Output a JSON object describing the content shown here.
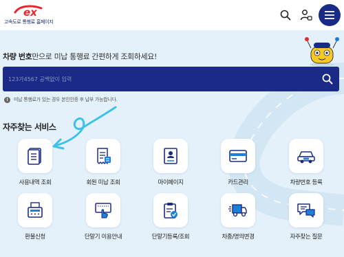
{
  "header": {
    "logo_text": "고속도로 통행료 홈페이지"
  },
  "main": {
    "title_bold": "차량 번호",
    "title_rest": "만으로 미납 통행료 간편하게 조회하세요!",
    "search": {
      "placeholder": "123가4567 공백없이 입력"
    },
    "notice": "미납 통행료가 있는 경우 본인인증 후 납부 가능합니다.",
    "section_title": "자주찾는 서비스",
    "services": [
      {
        "label": "사용내역 조회",
        "icon": "document-list-icon"
      },
      {
        "label": "회원 미납 조회",
        "icon": "receipt-icon"
      },
      {
        "label": "마이페이지",
        "icon": "id-card-icon"
      },
      {
        "label": "카드관리",
        "icon": "credit-card-icon"
      },
      {
        "label": "차량번호 등록",
        "icon": "car-icon"
      },
      {
        "label": "환불신청",
        "icon": "cash-register-icon"
      },
      {
        "label": "단말기 이용안내",
        "icon": "terminal-touch-icon"
      },
      {
        "label": "단말기등록/조회",
        "icon": "clipboard-check-icon"
      },
      {
        "label": "차종/명의변경",
        "icon": "truck-icon"
      },
      {
        "label": "자주찾는 질문",
        "icon": "chat-bubbles-icon"
      }
    ]
  },
  "colors": {
    "navy": "#1b2a86",
    "brand_red": "#e8262e",
    "accent_blue": "#1e7fd6",
    "background": "#e4f1fa",
    "scribble_cyan": "#3ec1e6"
  }
}
